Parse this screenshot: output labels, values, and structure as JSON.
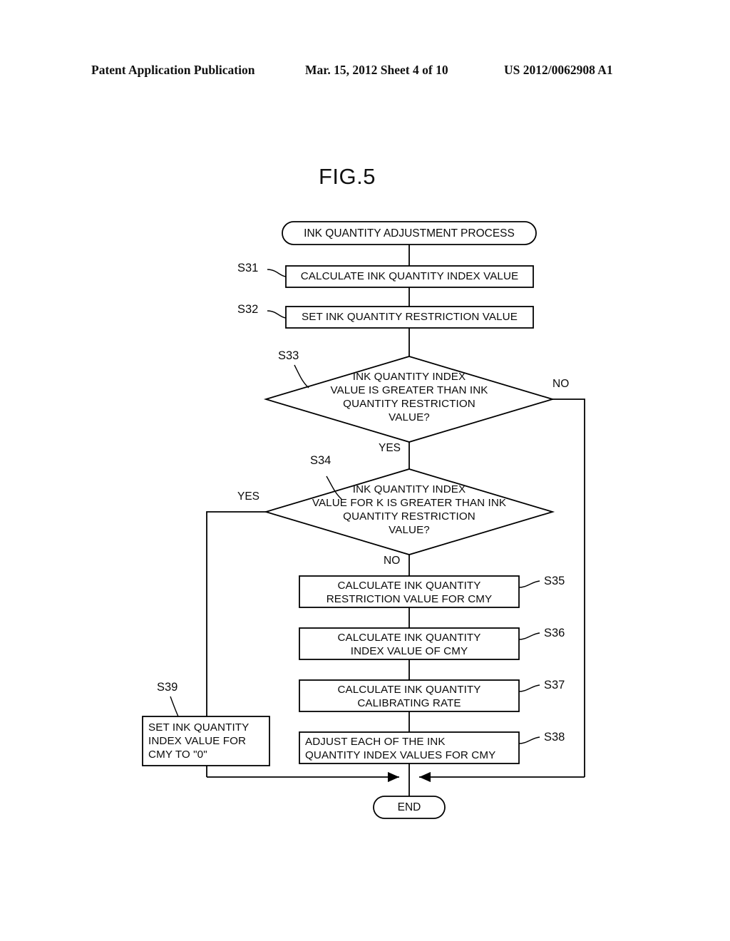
{
  "header": {
    "left": "Patent Application Publication",
    "middle": "Mar. 15, 2012  Sheet 4 of 10",
    "right": "US 2012/0062908 A1"
  },
  "figure": {
    "title": "FIG.5",
    "line_color": "#000000",
    "background": "#ffffff"
  },
  "flowchart": {
    "start": {
      "id": "start-terminator",
      "text": "INK QUANTITY ADJUSTMENT PROCESS"
    },
    "end": {
      "id": "end-terminator",
      "text": "END"
    },
    "steps": [
      {
        "id": "S31",
        "label": "S31",
        "text": "CALCULATE INK QUANTITY INDEX VALUE",
        "shape": "process",
        "align": "center"
      },
      {
        "id": "S32",
        "label": "S32",
        "text": "SET INK QUANTITY RESTRICTION VALUE",
        "shape": "process",
        "align": "center"
      },
      {
        "id": "S33",
        "label": "S33",
        "text": "INK QUANTITY INDEX\nVALUE IS GREATER THAN INK\nQUANTITY RESTRICTION\nVALUE?",
        "shape": "decision",
        "align": "center"
      },
      {
        "id": "S34",
        "label": "S34",
        "text": "INK QUANTITY INDEX\nVALUE FOR K IS GREATER THAN INK\nQUANTITY RESTRICTION\nVALUE?",
        "shape": "decision",
        "align": "center"
      },
      {
        "id": "S35",
        "label": "S35",
        "text": "CALCULATE INK QUANTITY\nRESTRICTION VALUE FOR CMY",
        "shape": "process",
        "align": "center"
      },
      {
        "id": "S36",
        "label": "S36",
        "text": "CALCULATE INK QUANTITY\nINDEX VALUE OF CMY",
        "shape": "process",
        "align": "center"
      },
      {
        "id": "S37",
        "label": "S37",
        "text": "CALCULATE INK QUANTITY\nCALIBRATING RATE",
        "shape": "process",
        "align": "center"
      },
      {
        "id": "S38",
        "label": "S38",
        "text": "ADJUST EACH OF THE INK\nQUANTITY INDEX VALUES FOR CMY",
        "shape": "process",
        "align": "left"
      },
      {
        "id": "S39",
        "label": "S39",
        "text": "SET INK QUANTITY\nINDEX VALUE FOR\nCMY TO \"0\"",
        "shape": "process",
        "align": "left"
      }
    ],
    "branches": [
      {
        "id": "s33-no",
        "label": "NO",
        "from": "S33",
        "direction": "right"
      },
      {
        "id": "s33-yes",
        "label": "YES",
        "from": "S33",
        "direction": "down"
      },
      {
        "id": "s34-yes",
        "label": "YES",
        "from": "S34",
        "direction": "left"
      },
      {
        "id": "s34-no",
        "label": "NO",
        "from": "S34",
        "direction": "down"
      }
    ]
  }
}
